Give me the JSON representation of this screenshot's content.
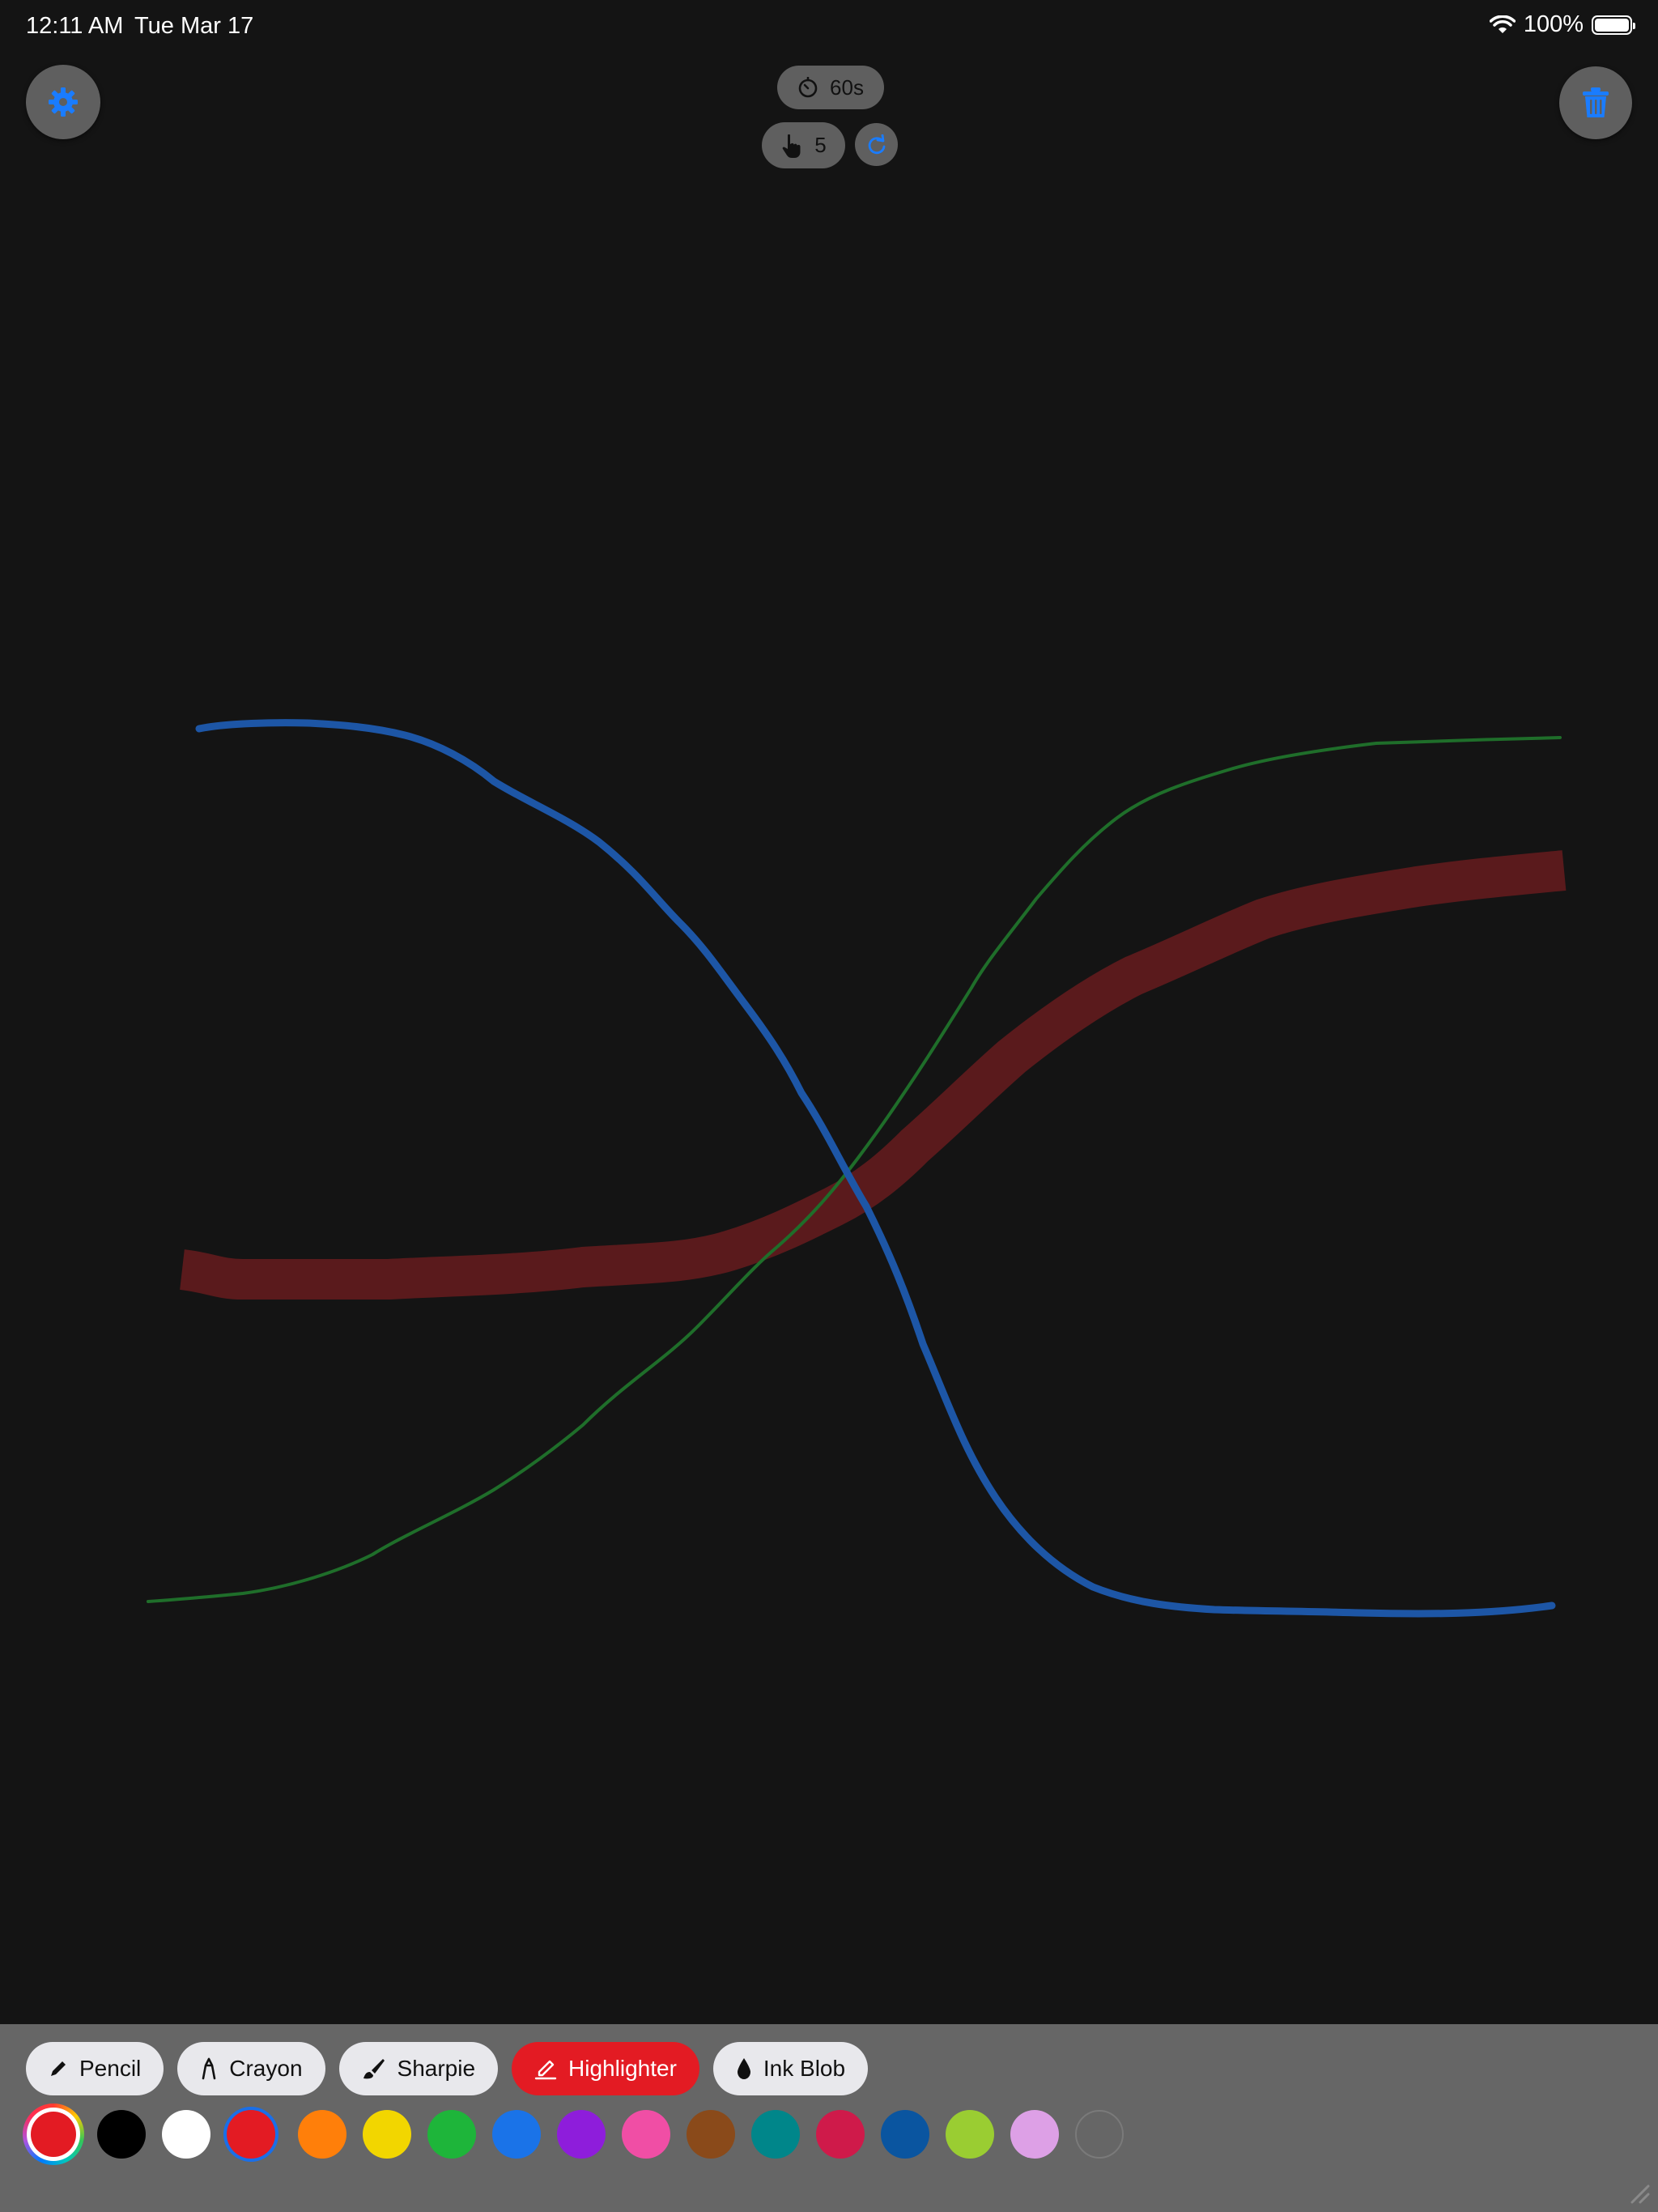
{
  "status_bar": {
    "time": "12:11 AM",
    "date": "Tue Mar 17",
    "battery": "100%"
  },
  "top_controls": {
    "timer_label": "60s",
    "touch_count": "5",
    "settings_icon": "gear-icon",
    "trash_icon": "trash-icon",
    "reset_icon": "reset-icon"
  },
  "canvas": {
    "strokes": [
      {
        "tool": "Highlighter",
        "color": "#5a1a1c"
      },
      {
        "tool": "Pencil",
        "color": "#1f6e2a"
      },
      {
        "tool": "Sharpie",
        "color": "#1d56a6"
      }
    ]
  },
  "toolbar": {
    "tools": [
      {
        "label": "Pencil",
        "icon": "pencil-icon",
        "active": false
      },
      {
        "label": "Crayon",
        "icon": "crayon-icon",
        "active": false
      },
      {
        "label": "Sharpie",
        "icon": "marker-icon",
        "active": false
      },
      {
        "label": "Highlighter",
        "icon": "highlighter-icon",
        "active": true
      },
      {
        "label": "Ink Blob",
        "icon": "ink-drop-icon",
        "active": false
      }
    ],
    "current_color": "#e31b23",
    "palette": [
      "#000000",
      "#ffffff",
      "#e31b23",
      "#ff7f0a",
      "#f2d600",
      "#1eb53a",
      "#1a73e8",
      "#8e1ddb",
      "#f04ea5",
      "#8a4a1a",
      "#00868a",
      "#cf1a4a",
      "#0a55a0",
      "#9acd32",
      "#dda0e6",
      ""
    ],
    "selected_color": "#e31b23"
  }
}
